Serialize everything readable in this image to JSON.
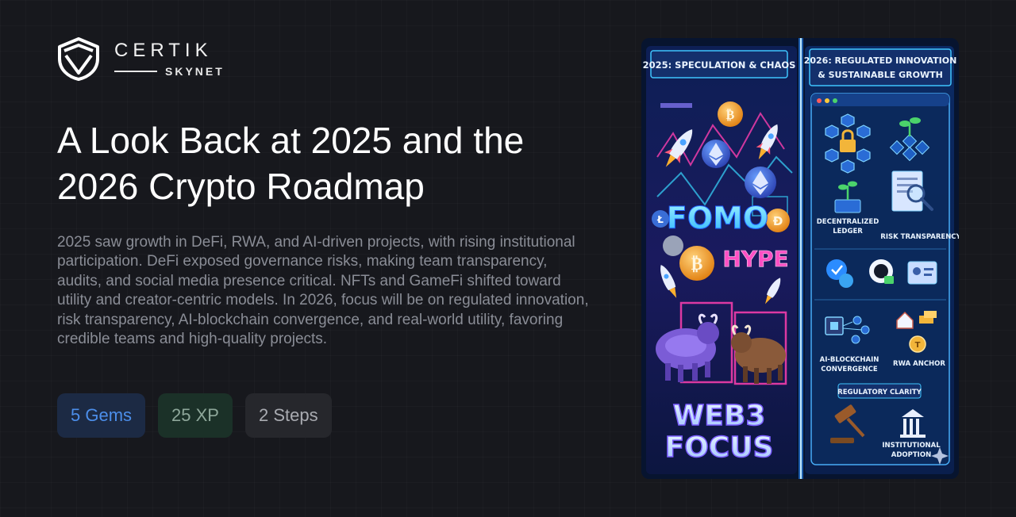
{
  "logo": {
    "brand": "CERTIK",
    "product": "SKYNET",
    "icon": "certik-shield-icon"
  },
  "title": "A Look Back at 2025 and the 2026 Crypto Roadmap",
  "description": "2025 saw growth in DeFi, RWA, and AI-driven projects, with rising institutional participation. DeFi exposed governance risks, making team transparency, audits, and social media presence critical. NFTs and GameFi shifted toward utility and creator-centric models. In 2026, focus will be on regulated innovation, risk transparency, AI-blockchain convergence, and real-world utility, favoring credible teams and high-quality projects.",
  "badges": {
    "gems": "5 Gems",
    "xp": "25 XP",
    "steps": "2 Steps"
  },
  "hero": {
    "left_header": "2025: SPECULATION & CHAOS",
    "right_header_line1": "2026: REGULATED INNOVATION",
    "right_header_line2": "& SUSTAINABLE GROWTH",
    "fomo": "FOMO",
    "hype": "HYPE",
    "web3": "WEB3",
    "focus": "FOCUS",
    "decentralized_ledger_1": "DECENTRALIZED",
    "decentralized_ledger_2": "LEDGER",
    "risk_transparency": "RISK TRANSPARENCY",
    "ai_blockchain_1": "AI-BLOCKCHAIN",
    "ai_blockchain_2": "CONVERGENCE",
    "rwa_anchor": "RWA ANCHOR",
    "regulatory_clarity": "REGULATORY CLARITY",
    "institutional_1": "INSTITUTIONAL",
    "institutional_2": "ADOPTION",
    "colors": {
      "neon_pink": "#ff3fb0",
      "neon_cyan": "#38d9ff",
      "btc_orange": "#f7931a"
    }
  }
}
